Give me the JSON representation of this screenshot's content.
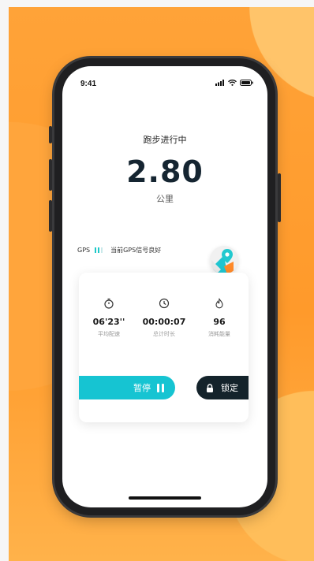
{
  "status_bar": {
    "time": "9:41"
  },
  "run": {
    "title": "跑步进行中",
    "distance": "2.80",
    "unit": "公里"
  },
  "gps": {
    "label": "GPS",
    "signal_level": 2,
    "signal_max": 3,
    "status": "当前GPS信号良好"
  },
  "stats": [
    {
      "icon": "stopwatch-icon",
      "value": "06'23''",
      "label": "平均配速"
    },
    {
      "icon": "clock-icon",
      "value": "00:00:07",
      "label": "总计时长"
    },
    {
      "icon": "flame-icon",
      "value": "96",
      "label": "消耗能量"
    }
  ],
  "controls": {
    "pause_label": "暂停",
    "lock_label": "锁定"
  },
  "colors": {
    "accent": "#16c4d2",
    "dark": "#14232b",
    "background": "#ffa338"
  }
}
